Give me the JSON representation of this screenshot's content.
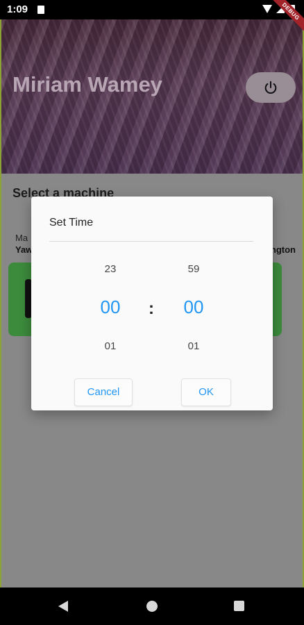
{
  "statusbar": {
    "time": "1:09"
  },
  "debug_banner": "DEBUG",
  "header": {
    "user_name": "Miriam Wamey"
  },
  "content": {
    "section_title": "Select a machine",
    "left_label": "Ma",
    "left_value": "Yaw",
    "right_value": "ngton"
  },
  "dialog": {
    "title": "Set Time",
    "hours": {
      "prev": "23",
      "current": "00",
      "next": "01"
    },
    "separator": ":",
    "minutes": {
      "prev": "59",
      "current": "00",
      "next": "01"
    },
    "cancel_label": "Cancel",
    "ok_label": "OK"
  },
  "colors": {
    "accent": "#2196f3",
    "card_green": "#3c8b3c",
    "debug": "#a3232b"
  },
  "icons": [
    "power-icon",
    "wifi-icon",
    "signal-icon",
    "battery-icon",
    "back-icon",
    "home-icon",
    "recents-icon"
  ]
}
